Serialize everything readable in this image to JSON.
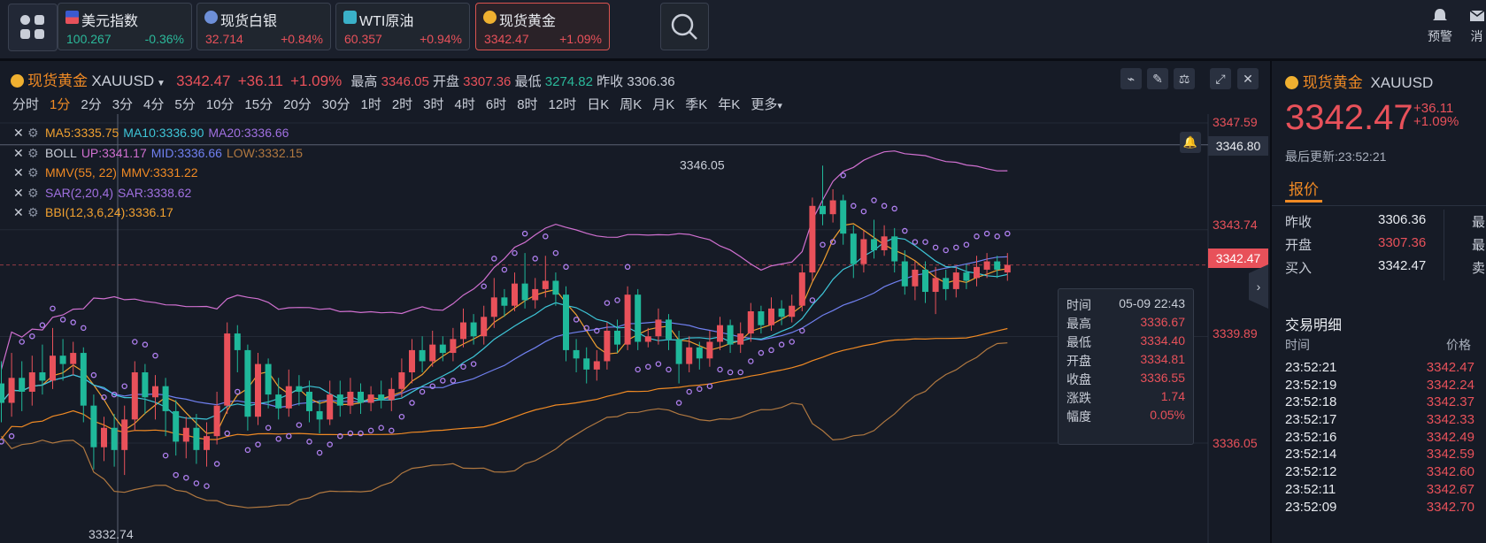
{
  "tickers": [
    {
      "name": "美元指数",
      "price": "100.267",
      "change": "-0.36%",
      "icon": "us-flag-icon",
      "tone": "green"
    },
    {
      "name": "现货白银",
      "price": "32.714",
      "change": "+0.84%",
      "icon": "silver-icon",
      "tone": "red"
    },
    {
      "name": "WTI原油",
      "price": "60.357",
      "change": "+0.94%",
      "icon": "oil-icon",
      "tone": "red"
    },
    {
      "name": "现货黄金",
      "price": "3342.47",
      "change": "+1.09%",
      "icon": "gold-icon",
      "tone": "red"
    }
  ],
  "topbar": {
    "alert_label": "预警",
    "message_label": "消"
  },
  "header": {
    "name": "现货黄金",
    "symbol": "XAUUSD",
    "price": "3342.47",
    "change": "+36.11",
    "change_pct": "+1.09%",
    "high_label": "最高",
    "high": "3346.05",
    "open_label": "开盘",
    "open": "3307.36",
    "low_label": "最低",
    "low": "3274.82",
    "prev_label": "昨收",
    "prev": "3306.36"
  },
  "periods": [
    "分时",
    "1分",
    "2分",
    "3分",
    "4分",
    "5分",
    "10分",
    "15分",
    "20分",
    "30分",
    "1时",
    "2时",
    "3时",
    "4时",
    "6时",
    "8时",
    "12时",
    "日K",
    "周K",
    "月K",
    "季K",
    "年K",
    "更多"
  ],
  "active_period": "1分",
  "indicators": [
    {
      "parts": [
        {
          "t": "MA5:3335.75",
          "c": "#f0a030"
        },
        {
          "t": "MA10:3336.90",
          "c": "#3ec6d8"
        },
        {
          "t": "MA20:3336.66",
          "c": "#a070e0"
        }
      ]
    },
    {
      "parts": [
        {
          "t": "BOLL",
          "c": "#c9ced8"
        },
        {
          "t": "UP:3341.17",
          "c": "#d070d0"
        },
        {
          "t": "MID:3336.66",
          "c": "#7080f0"
        },
        {
          "t": "LOW:3332.15",
          "c": "#b07840"
        }
      ]
    },
    {
      "parts": [
        {
          "t": "MMV(55, 22)",
          "c": "#f08a24"
        },
        {
          "t": "MMV:3331.22",
          "c": "#f08a24"
        }
      ]
    },
    {
      "parts": [
        {
          "t": "SAR(2,20,4)",
          "c": "#a070e0"
        },
        {
          "t": "SAR:3338.62",
          "c": "#a070e0"
        }
      ]
    },
    {
      "parts": [
        {
          "t": "BBI(12,3,6,24):3336.17",
          "c": "#f0a030"
        }
      ]
    }
  ],
  "axis_labels": [
    "3347.59",
    "3343.74",
    "3339.89",
    "3336.05"
  ],
  "crosshair_price": "3346.80",
  "last_price_tag": "3342.47",
  "high_annotation": "3346.05",
  "low_annotation": "3332.74",
  "tooltip": {
    "rows": [
      {
        "k": "时间",
        "v": "05-09 22:43",
        "tone": "plain"
      },
      {
        "k": "最高",
        "v": "3336.67",
        "tone": "red"
      },
      {
        "k": "最低",
        "v": "3334.40",
        "tone": "red"
      },
      {
        "k": "开盘",
        "v": "3334.81",
        "tone": "red"
      },
      {
        "k": "收盘",
        "v": "3336.55",
        "tone": "red"
      },
      {
        "k": "涨跌",
        "v": "1.74",
        "tone": "red"
      },
      {
        "k": "幅度",
        "v": "0.05%",
        "tone": "red"
      }
    ]
  },
  "side": {
    "name": "现货黄金",
    "symbol": "XAUUSD",
    "price": "3342.47",
    "change": "+36.11",
    "change_pct": "+1.09%",
    "updated": "最后更新:23:52:21",
    "tab": "报价",
    "quotes": [
      {
        "k": "昨收",
        "v": "3306.36",
        "tone": "plain",
        "k2": "最"
      },
      {
        "k": "开盘",
        "v": "3307.36",
        "tone": "red",
        "k2": "最"
      },
      {
        "k": "买入",
        "v": "3342.47",
        "tone": "plain",
        "k2": "卖"
      }
    ],
    "trades_title": "交易明细",
    "trades_col_time": "时间",
    "trades_col_price": "价格",
    "trades": [
      {
        "t": "23:52:21",
        "p": "3342.47"
      },
      {
        "t": "23:52:19",
        "p": "3342.24"
      },
      {
        "t": "23:52:18",
        "p": "3342.37"
      },
      {
        "t": "23:52:17",
        "p": "3342.33"
      },
      {
        "t": "23:52:16",
        "p": "3342.49"
      },
      {
        "t": "23:52:14",
        "p": "3342.59"
      },
      {
        "t": "23:52:12",
        "p": "3342.60"
      },
      {
        "t": "23:52:11",
        "p": "3342.67"
      },
      {
        "t": "23:52:09",
        "p": "3342.70"
      }
    ]
  },
  "colors": {
    "up": "#e8515a",
    "down": "#1fb89a",
    "accent": "#f08a24",
    "background": "#161b26"
  }
}
